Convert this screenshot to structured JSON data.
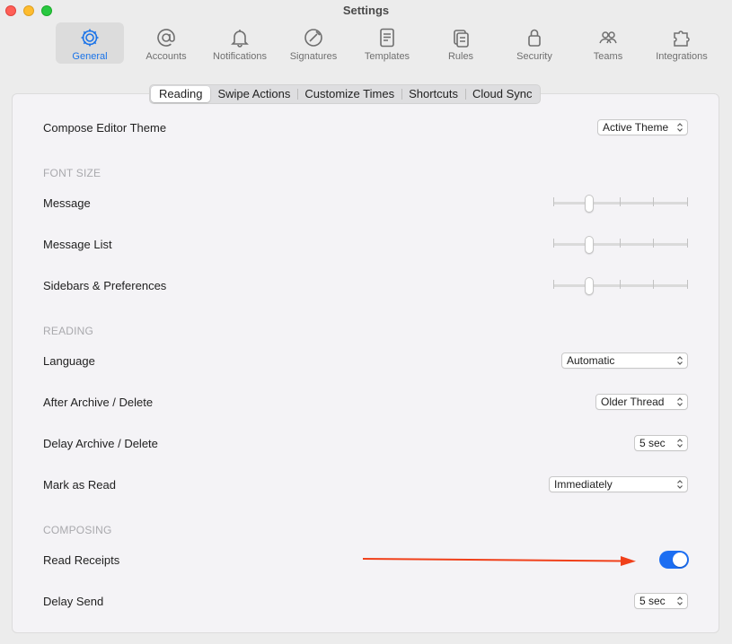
{
  "window": {
    "title": "Settings"
  },
  "toolbar": {
    "items": [
      {
        "label": "General",
        "icon": "gear-icon",
        "active": true
      },
      {
        "label": "Accounts",
        "icon": "at-sign-icon"
      },
      {
        "label": "Notifications",
        "icon": "bell-icon"
      },
      {
        "label": "Signatures",
        "icon": "signature-icon"
      },
      {
        "label": "Templates",
        "icon": "document-icon"
      },
      {
        "label": "Rules",
        "icon": "rules-icon"
      },
      {
        "label": "Security",
        "icon": "lock-icon"
      },
      {
        "label": "Teams",
        "icon": "people-icon"
      },
      {
        "label": "Integrations",
        "icon": "puzzle-icon"
      }
    ]
  },
  "tabs": [
    "Reading",
    "Swipe Actions",
    "Customize Times",
    "Shortcuts",
    "Cloud Sync"
  ],
  "active_tab": "Reading",
  "settings": {
    "compose_theme": {
      "label": "Compose Editor Theme",
      "value": "Active Theme"
    },
    "font_size_header": "FONT SIZE",
    "message": {
      "label": "Message",
      "level": 0.25
    },
    "message_list": {
      "label": "Message List",
      "level": 0.25
    },
    "sidebars": {
      "label": "Sidebars & Preferences",
      "level": 0.25
    },
    "reading_header": "READING",
    "language": {
      "label": "Language",
      "value": "Automatic"
    },
    "after_archive": {
      "label": "After Archive / Delete",
      "value": "Older Thread"
    },
    "delay_archive": {
      "label": "Delay Archive / Delete",
      "value": "5 sec"
    },
    "mark_as_read": {
      "label": "Mark as Read",
      "value": "Immediately"
    },
    "composing_header": "COMPOSING",
    "read_receipts": {
      "label": "Read Receipts",
      "enabled": true
    },
    "delay_send": {
      "label": "Delay Send",
      "value": "5 sec"
    }
  },
  "colors": {
    "accent": "#1c6ef2",
    "annotation_arrow": "#f0401a"
  }
}
